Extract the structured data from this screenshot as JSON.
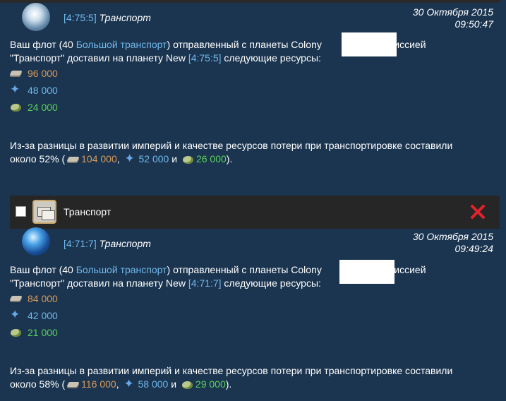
{
  "messages": [
    {
      "coords": "[4:75:5]",
      "subject": "Транспорт",
      "date": "30 Октября 2015",
      "time": "09:50:47",
      "body_part1": "Ваш флот (40 ",
      "ship_link": "Большой транспорт",
      "body_part2": ") отправленный с планеты Colony ",
      "body_part3": "с миссией",
      "body_part4": "\"Транспорт\" доставил на планету New ",
      "target_coords": "[4:75:5]",
      "body_part5": " следующие ресурсы:",
      "metal": "96 000",
      "crystal": "48 000",
      "deut": "24 000",
      "loss_part1": "Из-за разницы в развитии империй и качестве ресурсов потери при транспортировке составили",
      "loss_part2": "около 52% (",
      "loss_metal": "104 000",
      "loss_crystal": "52 000",
      "loss_and": " и ",
      "loss_deut": "26 000",
      "loss_end": ")."
    },
    {
      "coords": "[4:71:7]",
      "subject": "Транспорт",
      "date": "30 Октября 2015",
      "time": "09:49:24",
      "body_part1": "Ваш флот (40 ",
      "ship_link": "Большой транспорт",
      "body_part2": ") отправленный с планеты Colony ",
      "body_part3": "с миссией",
      "body_part4": "\"Транспорт\" доставил на планету New ",
      "target_coords": "[4:71:7]",
      "body_part5": " следующие ресурсы:",
      "metal": "84 000",
      "crystal": "42 000",
      "deut": "21 000",
      "loss_part1": "Из-за разницы в развитии империй и качестве ресурсов потери при транспортировке составили",
      "loss_part2": "около 58% (",
      "loss_metal": "116 000",
      "loss_crystal": "58 000",
      "loss_and": " и ",
      "loss_deut": "29 000",
      "loss_end": ")."
    }
  ],
  "toolbar": {
    "type_label": "Транспорт",
    "type_icon": "messages-icon",
    "close_icon": "close-icon"
  },
  "colors": {
    "background": "#1b3550",
    "link": "#6fb7ea",
    "metal": "#d99a5a",
    "crystal": "#6fb7ea",
    "deuterium": "#5ad05a",
    "delete": "#e3232b"
  }
}
